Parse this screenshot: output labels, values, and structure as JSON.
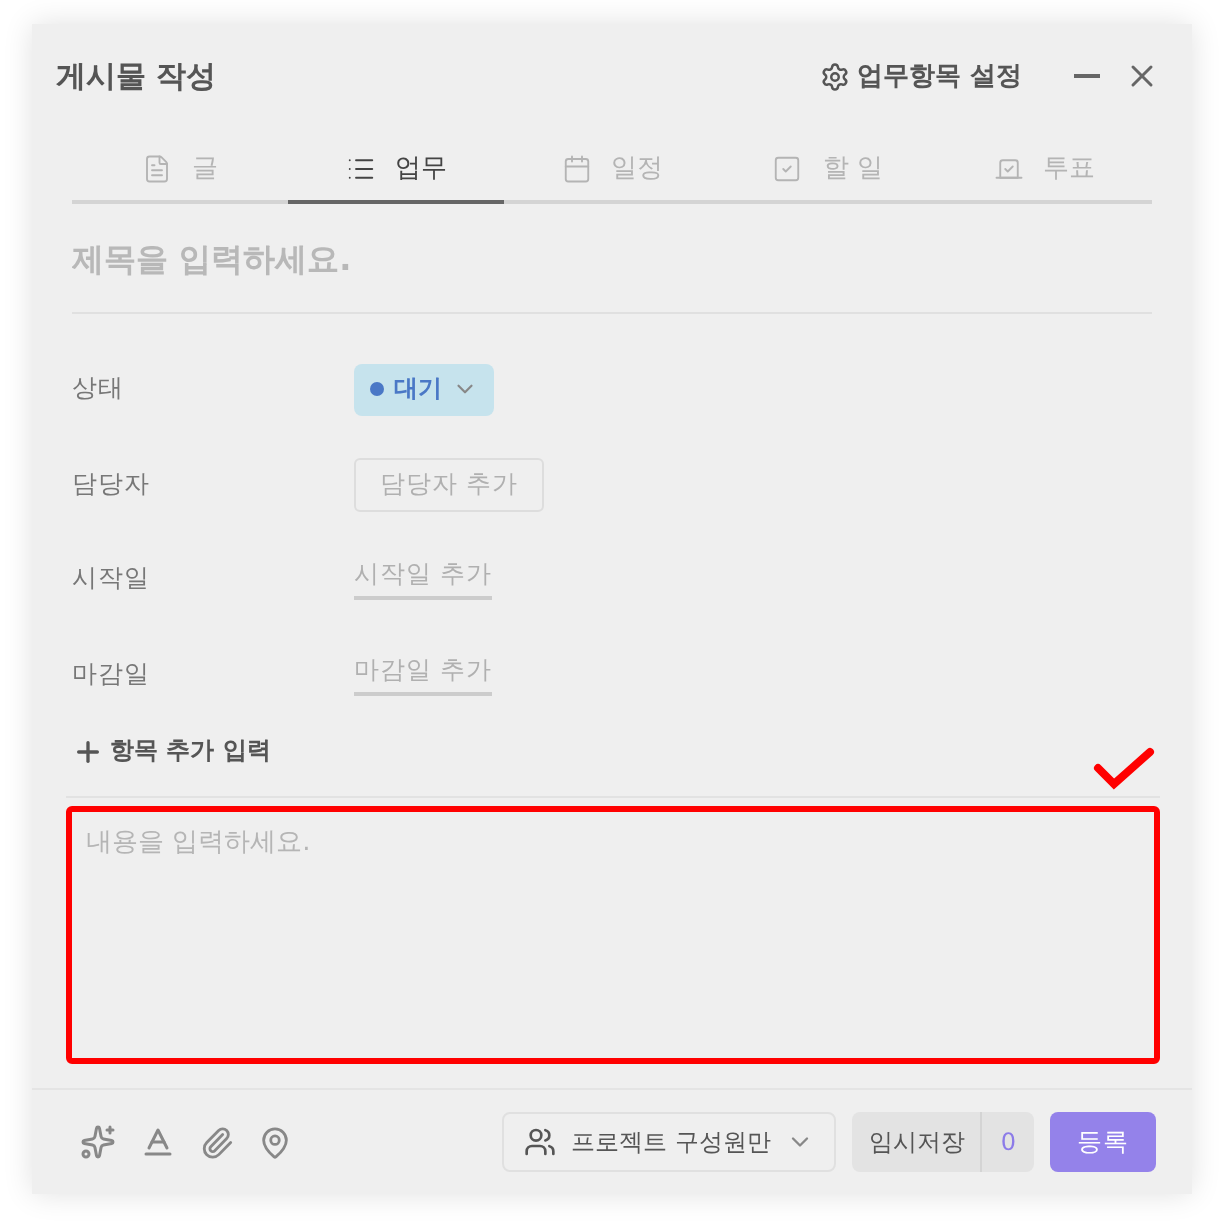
{
  "dialog": {
    "title": "게시물 작성",
    "settings_link": "업무항목 설정"
  },
  "tabs": [
    {
      "label": "글",
      "selected": false
    },
    {
      "label": "업무",
      "selected": true
    },
    {
      "label": "일정",
      "selected": false
    },
    {
      "label": "할 일",
      "selected": false
    },
    {
      "label": "투표",
      "selected": false
    }
  ],
  "title_field": {
    "placeholder": "제목을 입력하세요."
  },
  "fields": [
    {
      "label": "상태",
      "kind": "status",
      "value": "대기"
    },
    {
      "label": "담당자",
      "kind": "box",
      "action": "담당자 추가"
    },
    {
      "label": "시작일",
      "kind": "link",
      "action": "시작일 추가"
    },
    {
      "label": "마감일",
      "kind": "link",
      "action": "마감일 추가"
    }
  ],
  "add_item": "항목 추가 입력",
  "body": {
    "placeholder": "내용을 입력하세요."
  },
  "footer": {
    "visibility": "프로젝트 구성원만",
    "draft": "임시저장",
    "draft_count": "0",
    "submit": "등록"
  }
}
